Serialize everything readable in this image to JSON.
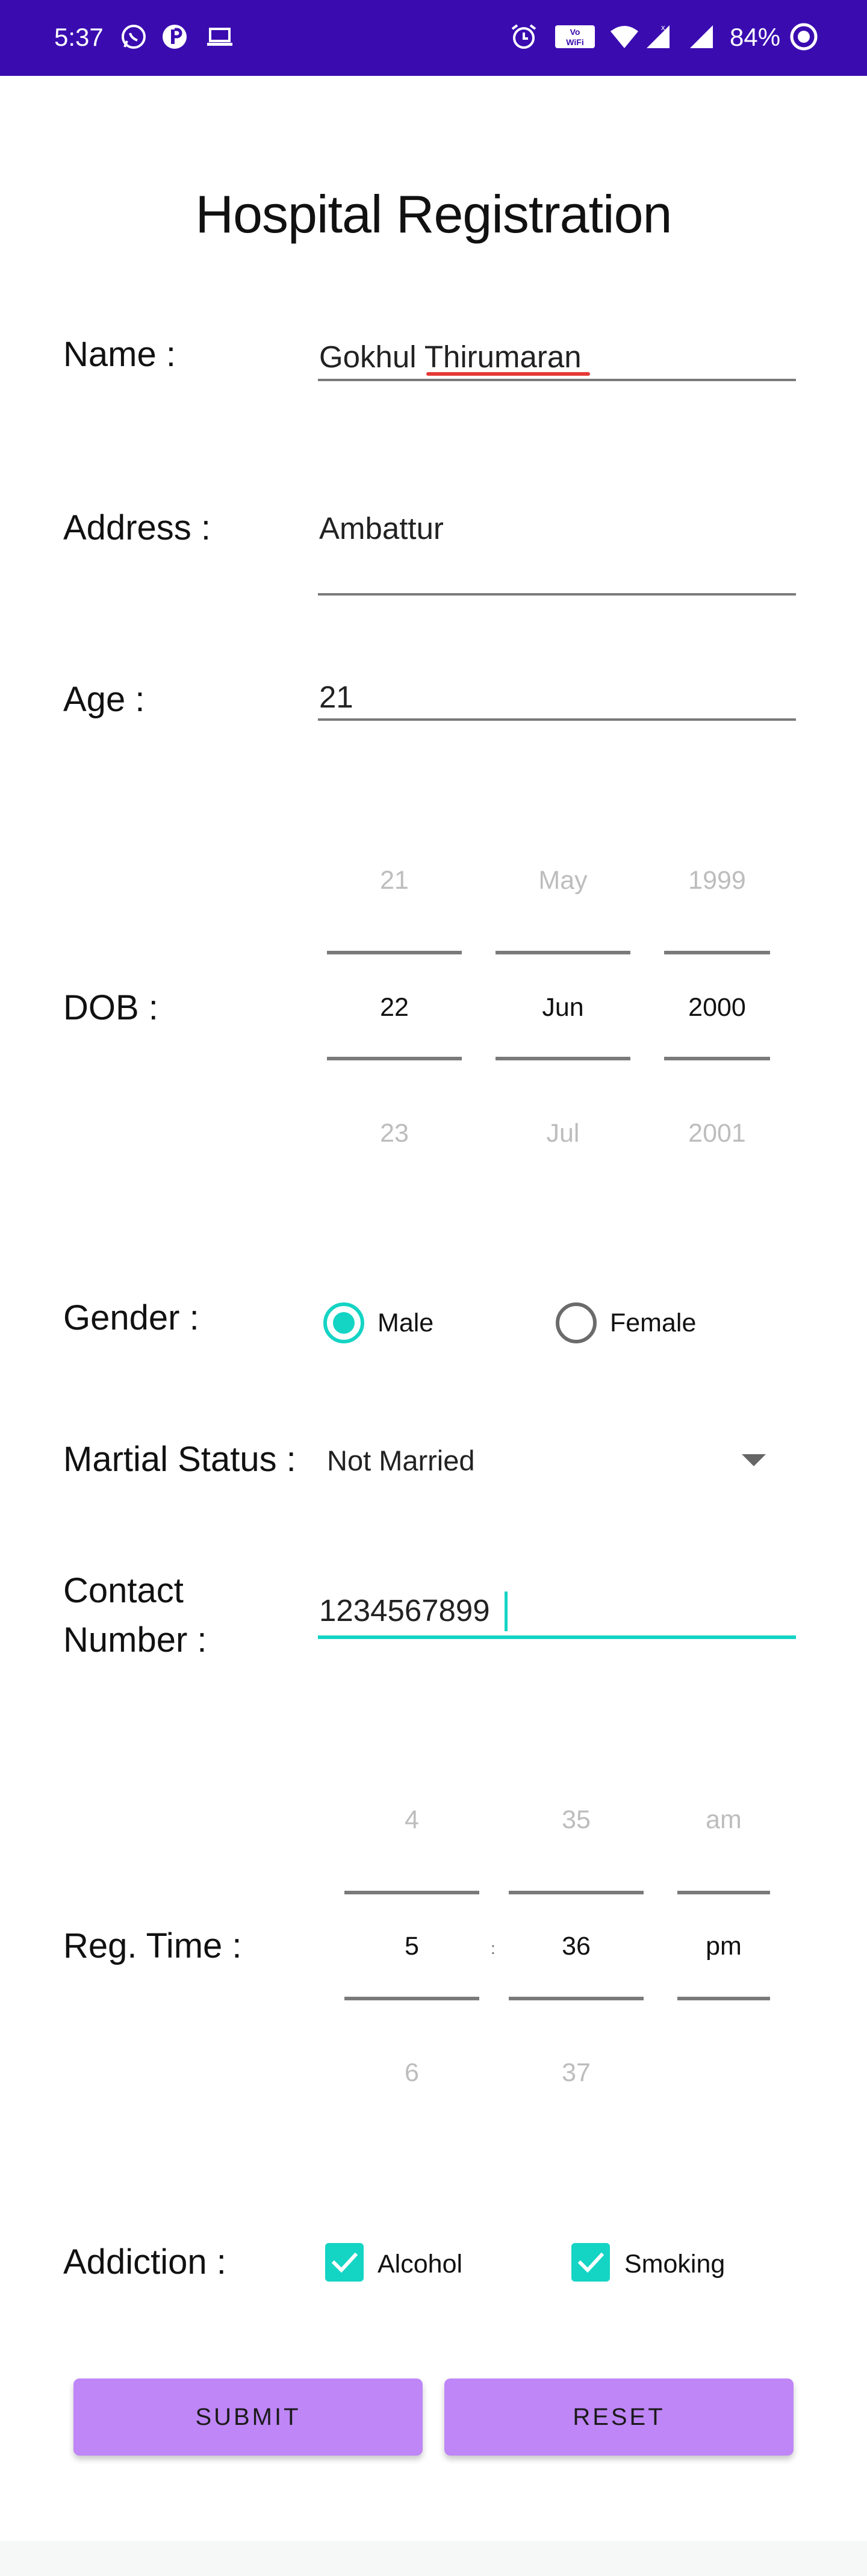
{
  "status_bar": {
    "time": "5:37",
    "battery": "84%",
    "bg_color": "#3a0cb0",
    "left_icons": [
      "whatsapp-icon",
      "app-icon",
      "laptop-icon"
    ],
    "right_icons": [
      "alarm-icon",
      "vowifi-icon",
      "wifi-icon",
      "signal-icon",
      "battery-icon"
    ],
    "vowifi_text": "Vo WiFi"
  },
  "form": {
    "title": "Hospital Registration",
    "name": {
      "label": "Name :",
      "value": "Gokhul Thirumaran"
    },
    "address": {
      "label": "Address :",
      "value": "Ambattur"
    },
    "age": {
      "label": "Age :",
      "value": "21"
    },
    "dob": {
      "label": "DOB :",
      "day": {
        "prev": "21",
        "selected": "22",
        "next": "23"
      },
      "month": {
        "prev": "May",
        "selected": "Jun",
        "next": "Jul"
      },
      "year": {
        "prev": "1999",
        "selected": "2000",
        "next": "2001"
      }
    },
    "gender": {
      "label": "Gender :",
      "options": [
        {
          "label": "Male",
          "selected": true
        },
        {
          "label": "Female",
          "selected": false
        }
      ]
    },
    "marital_status": {
      "label": "Martial Status :",
      "selected": "Not Married"
    },
    "contact": {
      "label_line1": "Contact",
      "label_line2": "Number :",
      "value": "1234567899"
    },
    "reg_time": {
      "label": "Reg. Time :",
      "hour": {
        "prev": "4",
        "selected": "5",
        "next": "6"
      },
      "minute": {
        "prev": "35",
        "selected": "36",
        "next": "37"
      },
      "ampm": {
        "prev": "am",
        "selected": "pm"
      },
      "separator": ":"
    },
    "addiction": {
      "label": "Addiction :",
      "options": [
        {
          "label": "Alcohol",
          "checked": true
        },
        {
          "label": "Smoking",
          "checked": true
        }
      ]
    },
    "submit_label": "SUBMIT",
    "reset_label": "RESET"
  },
  "colors": {
    "accent": "#14d4c4",
    "button": "#bf86f7",
    "status_bar": "#3a0cb0"
  }
}
